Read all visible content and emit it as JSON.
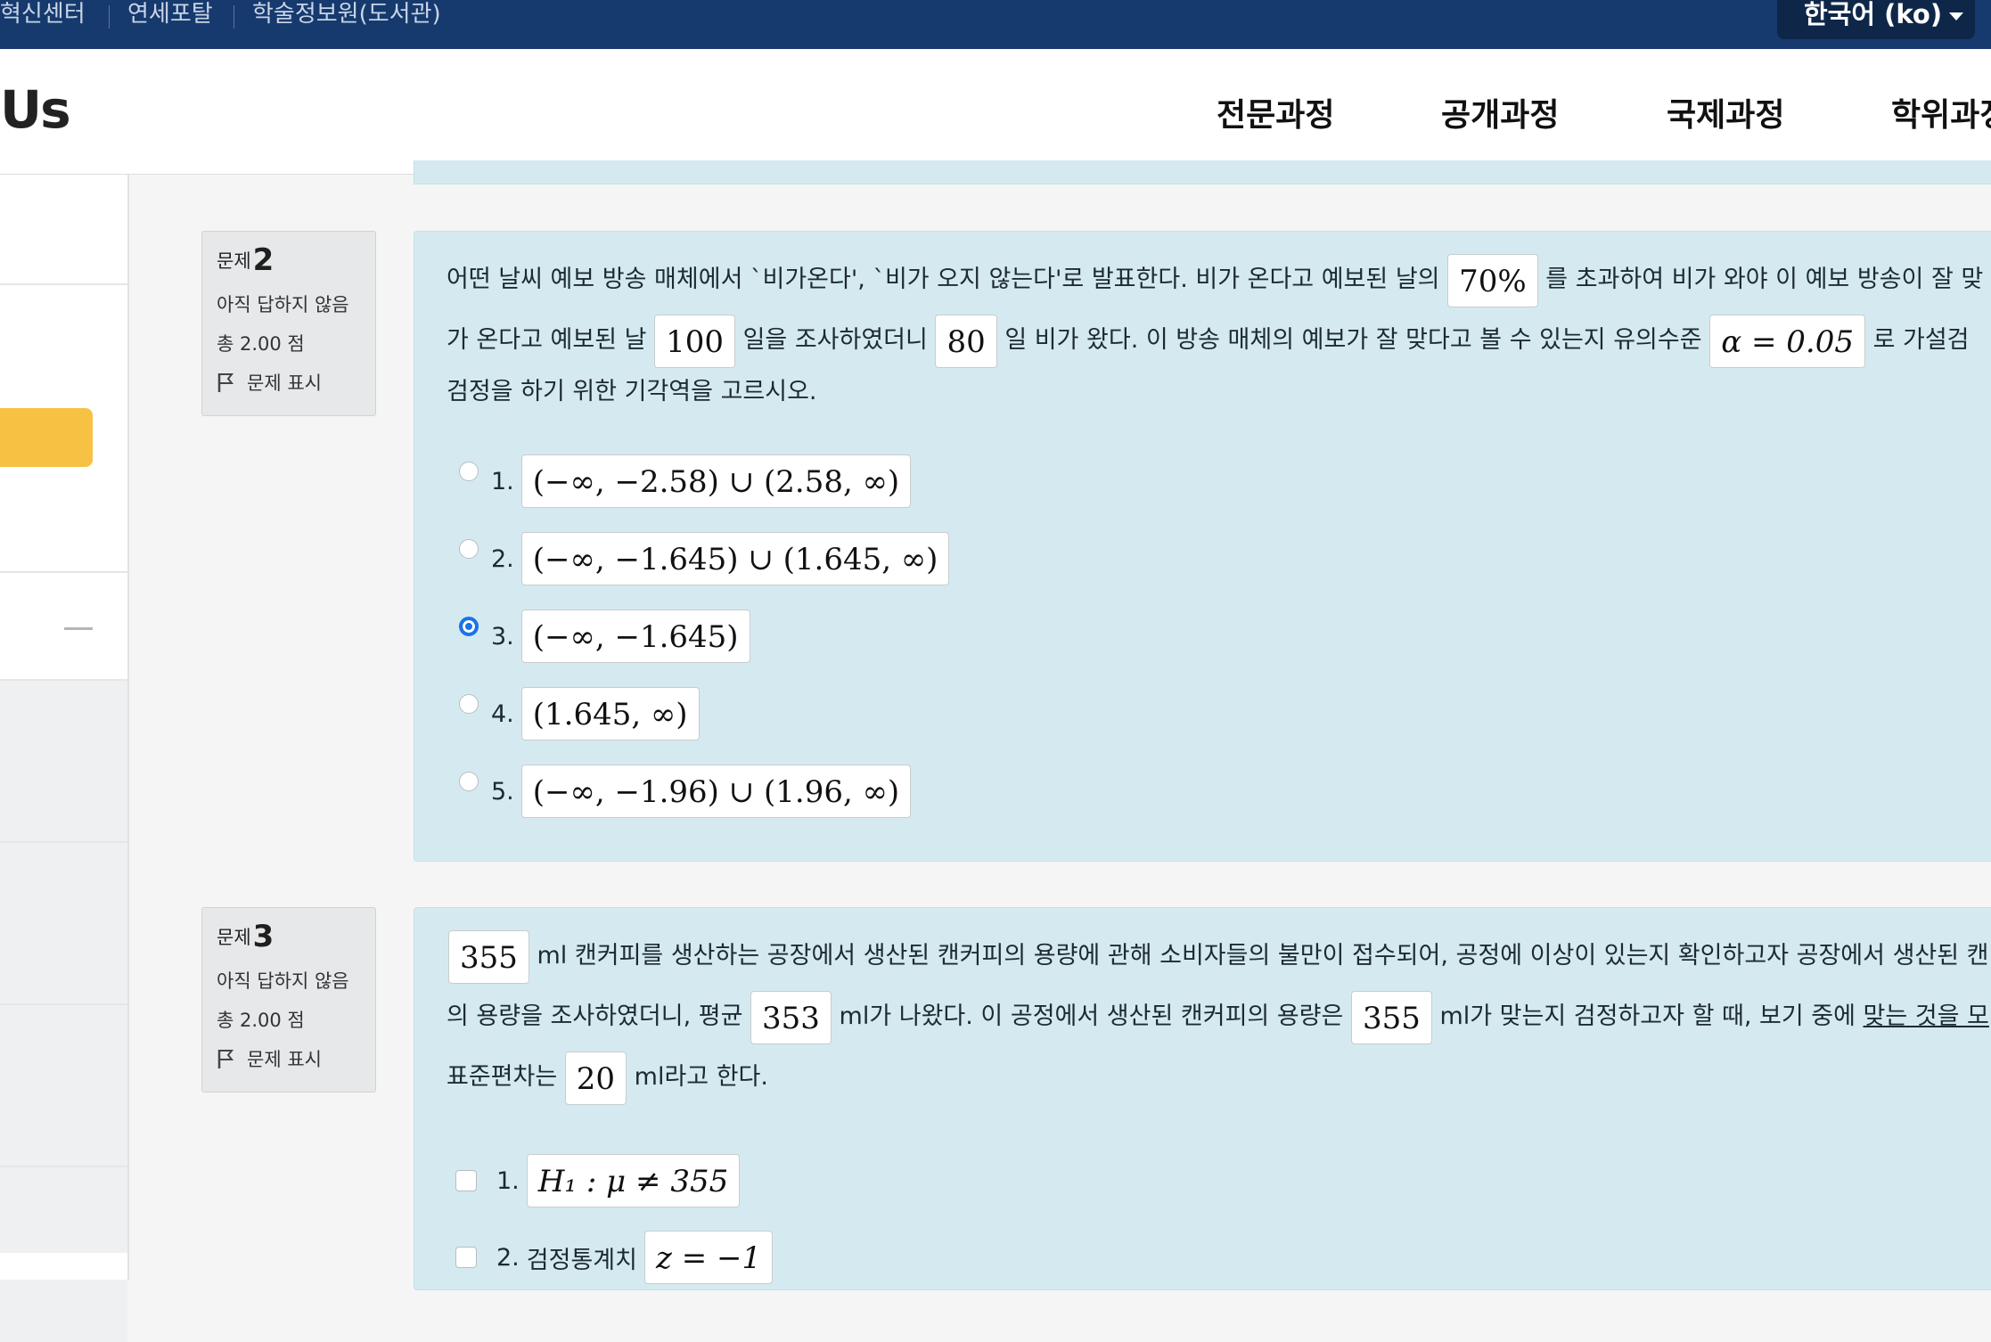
{
  "topbar": {
    "links": [
      "혁신센터",
      "연세포탈",
      "학술정보원(도서관)"
    ],
    "language": "한국어 (ko)"
  },
  "header": {
    "logo": "Us",
    "nav": [
      "전문과정",
      "공개과정",
      "국제과정",
      "학위과정"
    ]
  },
  "questions": [
    {
      "label": "문제",
      "number": "2",
      "state": "아직 답하지 않음",
      "mark": "총 2.00 점",
      "flag": "문제 표시",
      "text": {
        "l1a": "어떤 날씨 예보 방송 매체에서 `비가온다', `비가 오지 않는다'로 발표한다. 비가 온다고 예보된 날의",
        "m1": "70%",
        "l1b": "를 초과하여 비가 와야 이 예보 방송이 잘 맞",
        "l2a": "가 온다고 예보된 날",
        "m2": "100",
        "l2b": "일을 조사하였더니",
        "m3": "80",
        "l2c": "일 비가 왔다. 이 방송 매체의 예보가 잘 맞다고 볼 수 있는지 유의수준",
        "m4": "α = 0.05",
        "l2d": "로 가설검",
        "l3": "검정을 하기 위한 기각역을 고르시오."
      },
      "options": [
        {
          "num": "1.",
          "math": "(−∞, −2.58) ∪ (2.58, ∞)",
          "selected": false
        },
        {
          "num": "2.",
          "math": "(−∞, −1.645) ∪ (1.645, ∞)",
          "selected": false
        },
        {
          "num": "3.",
          "math": "(−∞, −1.645)",
          "selected": true
        },
        {
          "num": "4.",
          "math": "(1.645, ∞)",
          "selected": false
        },
        {
          "num": "5.",
          "math": "(−∞, −1.96) ∪ (1.96, ∞)",
          "selected": false
        }
      ]
    },
    {
      "label": "문제",
      "number": "3",
      "state": "아직 답하지 않음",
      "mark": "총 2.00 점",
      "flag": "문제 표시",
      "text": {
        "m1": "355",
        "l1a": "ml 캔커피를 생산하는 공장에서 생산된 캔커피의 용량에 관해 소비자들의 불만이 접수되어, 공정에 이상이 있는지 확인하고자 공장에서 생산된 캔",
        "l2a": "의 용량을 조사하였더니, 평균",
        "m2": "353",
        "l2b": "ml가 나왔다. 이 공정에서 생산된 캔커피의 용량은",
        "m3": "355",
        "l2c": "ml가 맞는지 검정하고자 할 때, 보기 중에",
        "l2d": "맞는 것을 모",
        "l3a": "표준편차는",
        "m4": "20",
        "l3b": "ml라고 한다."
      },
      "options": [
        {
          "num": "1.",
          "label": "",
          "math": "H₁ : μ ≠ 355"
        },
        {
          "num": "2.",
          "label": "검정통계치",
          "math": "z = −1"
        }
      ]
    }
  ],
  "colors": {
    "topbar": "#163a6e",
    "question_bg": "#d5eaf0",
    "accent_yellow": "#f7c244",
    "radio_selected": "#1a73e8"
  }
}
